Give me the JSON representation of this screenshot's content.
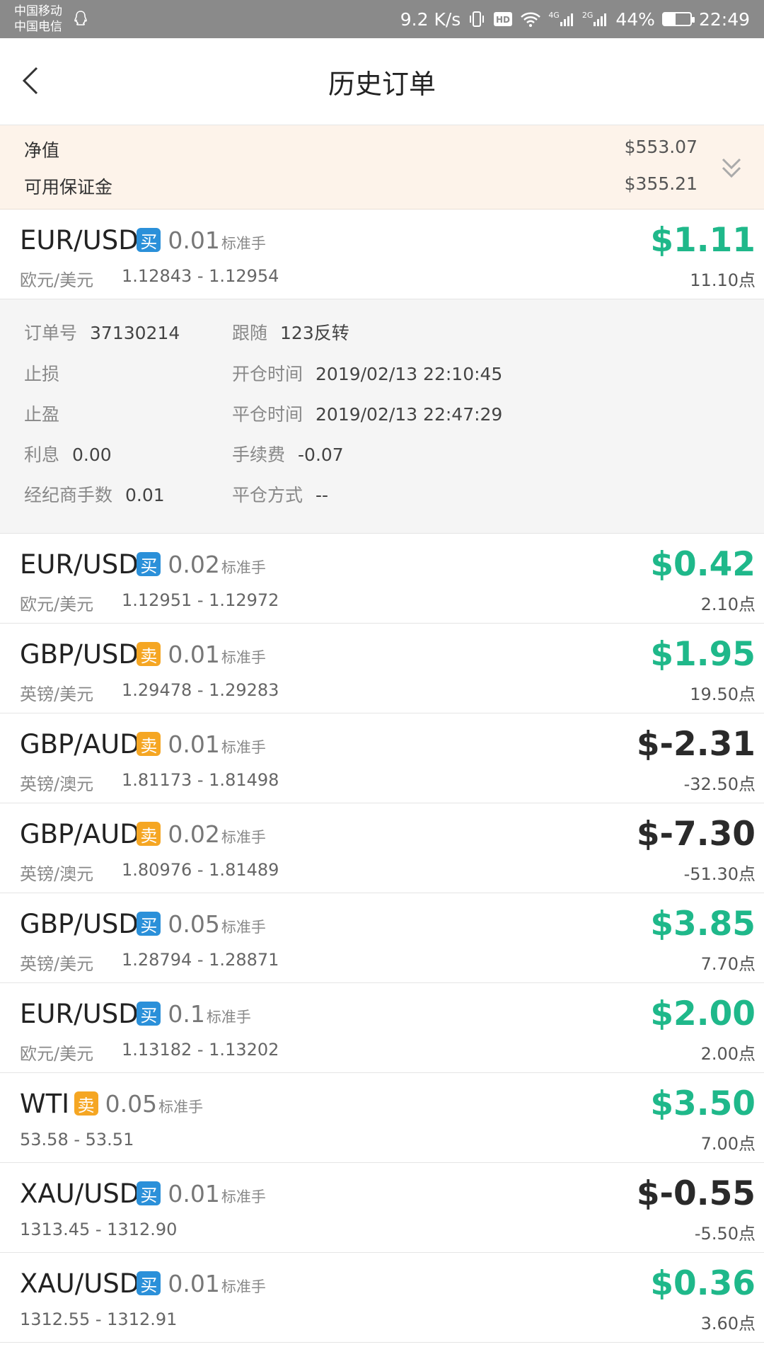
{
  "status_bar": {
    "carrier1": "中国移动",
    "carrier2": "中国电信",
    "speed": "9.2 K/s",
    "network1": "4G",
    "network2": "2G",
    "battery": "44%",
    "battery_level": 0.44,
    "time": "22:49"
  },
  "header": {
    "title": "历史订单"
  },
  "summary": {
    "net_label": "净值",
    "net_value": "$553.07",
    "margin_label": "可用保证金",
    "margin_value": "$355.21"
  },
  "detail": {
    "order_no_label": "订单号",
    "order_no": "37130214",
    "follow_label": "跟随",
    "follow": "123反转",
    "stop_loss_label": "止损",
    "stop_loss": "",
    "open_time_label": "开仓时间",
    "open_time": "2019/02/13 22:10:45",
    "take_profit_label": "止盈",
    "take_profit": "",
    "close_time_label": "平仓时间",
    "close_time": "2019/02/13 22:47:29",
    "interest_label": "利息",
    "interest": "0.00",
    "fee_label": "手续费",
    "fee": "-0.07",
    "broker_lots_label": "经纪商手数",
    "broker_lots": "0.01",
    "close_method_label": "平仓方式",
    "close_method": "--"
  },
  "orders": [
    {
      "symbol": "EUR/USD",
      "side": "买",
      "side_type": "buy",
      "lot": "0.01",
      "unit": "标准手",
      "name": "欧元/美元",
      "range": "1.12843 - 1.12954",
      "profit": "$1.11",
      "points": "11.10点",
      "positive": true
    },
    {
      "symbol": "EUR/USD",
      "side": "买",
      "side_type": "buy",
      "lot": "0.02",
      "unit": "标准手",
      "name": "欧元/美元",
      "range": "1.12951 - 1.12972",
      "profit": "$0.42",
      "points": "2.10点",
      "positive": true
    },
    {
      "symbol": "GBP/USD",
      "side": "卖",
      "side_type": "sell",
      "lot": "0.01",
      "unit": "标准手",
      "name": "英镑/美元",
      "range": "1.29478 - 1.29283",
      "profit": "$1.95",
      "points": "19.50点",
      "positive": true
    },
    {
      "symbol": "GBP/AUD",
      "side": "卖",
      "side_type": "sell",
      "lot": "0.01",
      "unit": "标准手",
      "name": "英镑/澳元",
      "range": "1.81173 - 1.81498",
      "profit": "$-2.31",
      "points": "-32.50点",
      "positive": false
    },
    {
      "symbol": "GBP/AUD",
      "side": "卖",
      "side_type": "sell",
      "lot": "0.02",
      "unit": "标准手",
      "name": "英镑/澳元",
      "range": "1.80976 - 1.81489",
      "profit": "$-7.30",
      "points": "-51.30点",
      "positive": false
    },
    {
      "symbol": "GBP/USD",
      "side": "买",
      "side_type": "buy",
      "lot": "0.05",
      "unit": "标准手",
      "name": "英镑/美元",
      "range": "1.28794 - 1.28871",
      "profit": "$3.85",
      "points": "7.70点",
      "positive": true
    },
    {
      "symbol": "EUR/USD",
      "side": "买",
      "side_type": "buy",
      "lot": "0.1",
      "unit": "标准手",
      "name": "欧元/美元",
      "range": "1.13182 - 1.13202",
      "profit": "$2.00",
      "points": "2.00点",
      "positive": true
    },
    {
      "symbol": "WTI",
      "side": "卖",
      "side_type": "sell",
      "lot": "0.05",
      "unit": "标准手",
      "name": "",
      "range": "53.58 - 53.51",
      "profit": "$3.50",
      "points": "7.00点",
      "positive": true
    },
    {
      "symbol": "XAU/USD",
      "side": "买",
      "side_type": "buy",
      "lot": "0.01",
      "unit": "标准手",
      "name": "",
      "range": "1313.45 - 1312.90",
      "profit": "$-0.55",
      "points": "-5.50点",
      "positive": false
    },
    {
      "symbol": "XAU/USD",
      "side": "买",
      "side_type": "buy",
      "lot": "0.01",
      "unit": "标准手",
      "name": "",
      "range": "1312.55 - 1312.91",
      "profit": "$0.36",
      "points": "3.60点",
      "positive": true
    }
  ]
}
